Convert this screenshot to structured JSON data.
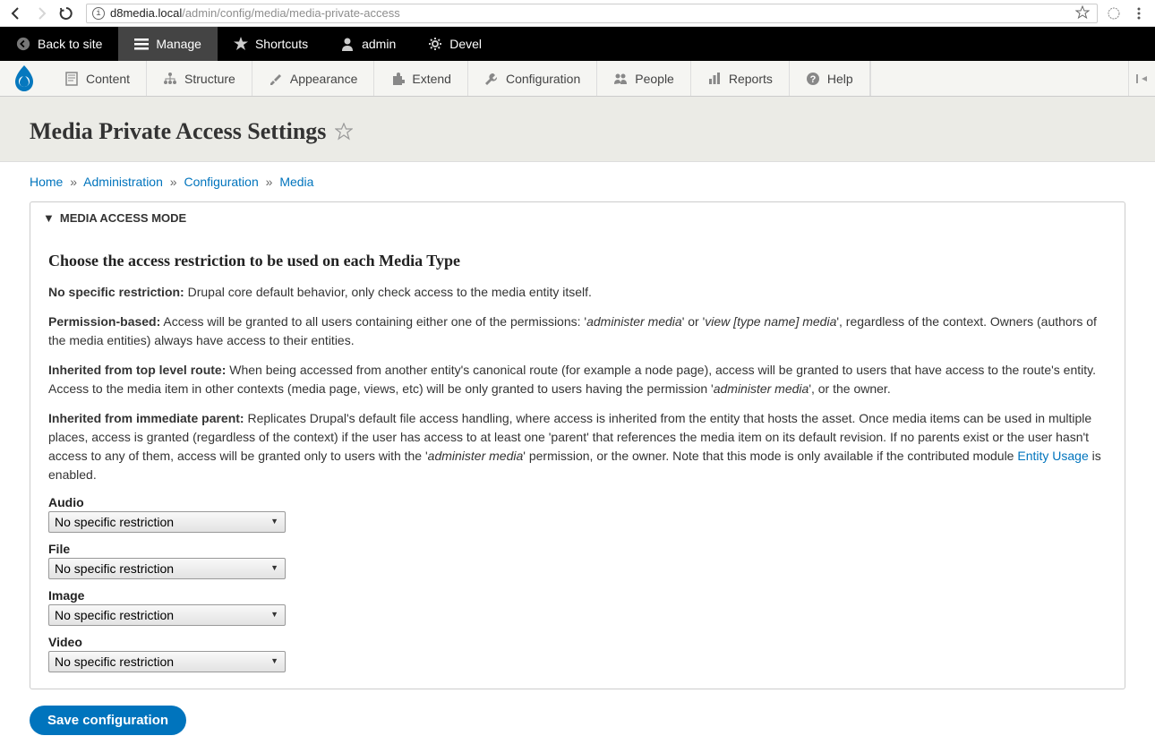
{
  "browser": {
    "host": "d8media.local",
    "path": "/admin/config/media/media-private-access"
  },
  "toolbar": {
    "back": "Back to site",
    "manage": "Manage",
    "shortcuts": "Shortcuts",
    "admin": "admin",
    "devel": "Devel"
  },
  "nav": [
    {
      "label": "Content"
    },
    {
      "label": "Structure"
    },
    {
      "label": "Appearance"
    },
    {
      "label": "Extend"
    },
    {
      "label": "Configuration"
    },
    {
      "label": "People"
    },
    {
      "label": "Reports"
    },
    {
      "label": "Help"
    }
  ],
  "page": {
    "title": "Media Private Access Settings"
  },
  "breadcrumb": [
    "Home",
    "Administration",
    "Configuration",
    "Media"
  ],
  "details": {
    "summary": "Media access mode",
    "heading": "Choose the access restriction to be used on each Media Type",
    "desc1_label": "No specific restriction:",
    "desc1_text": " Drupal core default behavior, only check access to the media entity itself.",
    "desc2_label": "Permission-based:",
    "desc2_a": " Access will be granted to all users containing either one of the permissions: '",
    "desc2_em1": "administer media",
    "desc2_b": "' or '",
    "desc2_em2": "view [type name] media",
    "desc2_c": "', regardless of the context. Owners (authors of the media entities) always have access to their entities.",
    "desc3_label": "Inherited from top level route:",
    "desc3_a": " When being accessed from another entity's canonical route (for example a node page), access will be granted to users that have access to the route's entity. Access to the media item in other contexts (media page, views, etc) will be only granted to users having the permission '",
    "desc3_em": "administer media",
    "desc3_b": "', or the owner.",
    "desc4_label": "Inherited from immediate parent:",
    "desc4_a": " Replicates Drupal's default file access handling, where access is inherited from the entity that hosts the asset. Once media items can be used in multiple places, access is granted (regardless of the context) if the user has access to at least one 'parent' that references the media item on its default revision. If no parents exist or the user hasn't access to any of them, access will be granted only to users with the '",
    "desc4_em": "administer media",
    "desc4_b": "' permission, or the owner. Note that this mode is only available if the contributed module ",
    "desc4_link": "Entity Usage",
    "desc4_c": " is enabled.",
    "fields": [
      {
        "label": "Audio",
        "value": "No specific restriction"
      },
      {
        "label": "File",
        "value": "No specific restriction"
      },
      {
        "label": "Image",
        "value": "No specific restriction"
      },
      {
        "label": "Video",
        "value": "No specific restriction"
      }
    ]
  },
  "actions": {
    "save": "Save configuration"
  }
}
